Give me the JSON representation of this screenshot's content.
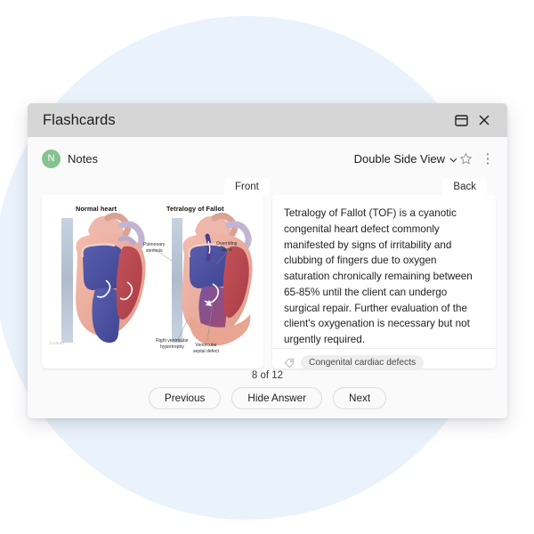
{
  "window": {
    "title": "Flashcards",
    "restore_icon": "window-restore-icon",
    "close_icon": "close-icon"
  },
  "toolbar": {
    "avatar_initial": "N",
    "avatar_color": "#85c391",
    "notes_label": "Notes",
    "view_mode": "Double Side View",
    "chevron_icon": "chevron-down-icon",
    "star_icon": "star-outline-icon",
    "more_icon": "kebab-menu-icon"
  },
  "cards": {
    "front_label": "Front",
    "back_label": "Back",
    "front": {
      "diagram": {
        "left_title": "Normal heart",
        "right_title": "Tetralogy of Fallot",
        "annotations": [
          "Pulmonary\nstenosis",
          "Overriding\naorta",
          "Right ventricular\nhypertrophy",
          "Ventricular\nseptal defect"
        ],
        "watermark": "©Lifeart"
      }
    },
    "back": {
      "text": "Tetralogy of Fallot (TOF) is a cyanotic congenital heart defect commonly manifested by signs of irritability and clubbing of fingers due to oxygen saturation chronically remaining between 65-85% until the client can undergo surgical repair.  Further evaluation of the client's oxygenation is necessary but not urgently required.",
      "tag_icon": "tag-icon",
      "tag": "Congenital cardiac defects"
    }
  },
  "footer": {
    "counter": "8 of 12",
    "previous_label": "Previous",
    "hide_answer_label": "Hide Answer",
    "next_label": "Next"
  }
}
